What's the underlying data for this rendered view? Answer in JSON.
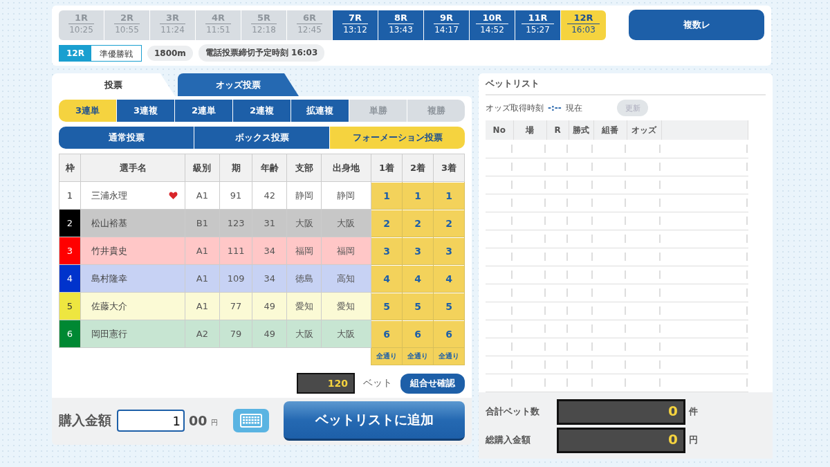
{
  "races": [
    {
      "label": "1R",
      "time": "10:25",
      "disabled": true,
      "selected": false
    },
    {
      "label": "2R",
      "time": "10:55",
      "disabled": true,
      "selected": false
    },
    {
      "label": "3R",
      "time": "11:24",
      "disabled": true,
      "selected": false
    },
    {
      "label": "4R",
      "time": "11:51",
      "disabled": true,
      "selected": false
    },
    {
      "label": "5R",
      "time": "12:18",
      "disabled": true,
      "selected": false
    },
    {
      "label": "6R",
      "time": "12:45",
      "disabled": true,
      "selected": false
    },
    {
      "label": "7R",
      "time": "13:12",
      "disabled": false,
      "selected": false
    },
    {
      "label": "8R",
      "time": "13:43",
      "disabled": false,
      "selected": false
    },
    {
      "label": "9R",
      "time": "14:17",
      "disabled": false,
      "selected": false
    },
    {
      "label": "10R",
      "time": "14:52",
      "disabled": false,
      "selected": false
    },
    {
      "label": "11R",
      "time": "15:27",
      "disabled": false,
      "selected": false
    },
    {
      "label": "12R",
      "time": "16:03",
      "disabled": false,
      "selected": true
    }
  ],
  "multi_race_button": "複数レ",
  "race_info": {
    "race": "12R",
    "name": "準優勝戦",
    "distance": "1800m",
    "deadline": "電話投票締切予定時刻 16:03"
  },
  "main_tabs": [
    {
      "label": "投票",
      "selected": true
    },
    {
      "label": "オッズ投票",
      "selected": false
    }
  ],
  "bet_types": [
    {
      "label": "3連単",
      "selected": true,
      "disabled": false
    },
    {
      "label": "3連複",
      "selected": false,
      "disabled": false
    },
    {
      "label": "2連単",
      "selected": false,
      "disabled": false
    },
    {
      "label": "2連複",
      "selected": false,
      "disabled": false
    },
    {
      "label": "拡連複",
      "selected": false,
      "disabled": false
    },
    {
      "label": "単勝",
      "selected": false,
      "disabled": true
    },
    {
      "label": "複勝",
      "selected": false,
      "disabled": true
    }
  ],
  "bet_methods": [
    {
      "label": "通常投票",
      "selected": false
    },
    {
      "label": "ボックス投票",
      "selected": false
    },
    {
      "label": "フォーメーション投票",
      "selected": true
    }
  ],
  "table": {
    "columns": [
      "枠",
      "選手名",
      "級別",
      "期",
      "年齢",
      "支部",
      "出身地",
      "1着",
      "2着",
      "3着"
    ],
    "rows": [
      {
        "frame": "1",
        "color": "#ffffff",
        "name": "三浦永理",
        "favorite": true,
        "class": "A1",
        "term": "91",
        "age": "42",
        "branch": "静岡",
        "birthplace": "静岡",
        "picks": [
          {
            "label": "1",
            "selected": true
          },
          {
            "label": "1",
            "selected": true
          },
          {
            "label": "1",
            "selected": true
          }
        ]
      },
      {
        "frame": "2",
        "color": "#000000",
        "name": "松山裕基",
        "favorite": false,
        "class": "B1",
        "term": "123",
        "age": "31",
        "branch": "大阪",
        "birthplace": "大阪",
        "picks": [
          {
            "label": "2",
            "selected": true
          },
          {
            "label": "2",
            "selected": true
          },
          {
            "label": "2",
            "selected": true
          }
        ]
      },
      {
        "frame": "3",
        "color": "#ff0000",
        "name": "竹井貴史",
        "favorite": false,
        "class": "A1",
        "term": "111",
        "age": "34",
        "branch": "福岡",
        "birthplace": "福岡",
        "picks": [
          {
            "label": "3",
            "selected": true
          },
          {
            "label": "3",
            "selected": true
          },
          {
            "label": "3",
            "selected": true
          }
        ]
      },
      {
        "frame": "4",
        "color": "#0033cc",
        "name": "島村隆幸",
        "favorite": false,
        "class": "A1",
        "term": "109",
        "age": "34",
        "branch": "徳島",
        "birthplace": "高知",
        "picks": [
          {
            "label": "4",
            "selected": true
          },
          {
            "label": "4",
            "selected": true
          },
          {
            "label": "4",
            "selected": true
          }
        ]
      },
      {
        "frame": "5",
        "color": "#eee640",
        "name": "佐藤大介",
        "favorite": false,
        "class": "A1",
        "term": "77",
        "age": "49",
        "branch": "愛知",
        "birthplace": "愛知",
        "picks": [
          {
            "label": "5",
            "selected": true
          },
          {
            "label": "5",
            "selected": true
          },
          {
            "label": "5",
            "selected": true
          }
        ]
      },
      {
        "frame": "6",
        "color": "#008833",
        "name": "岡田憲行",
        "favorite": false,
        "class": "A2",
        "term": "79",
        "age": "49",
        "branch": "大阪",
        "birthplace": "大阪",
        "picks": [
          {
            "label": "6",
            "selected": true
          },
          {
            "label": "6",
            "selected": true
          },
          {
            "label": "6",
            "selected": true
          }
        ]
      }
    ],
    "all_buttons": [
      "全通り",
      "全通り",
      "全通り"
    ]
  },
  "bet_count": {
    "value": "120",
    "unit": "ベット",
    "confirm": "組合せ確認"
  },
  "purchase": {
    "label": "購入金額",
    "value": "1",
    "suffix": "00",
    "unit": "円",
    "add_button": "ベットリストに追加"
  },
  "bet_list": {
    "title": "ベットリスト",
    "odds_time_label": "オッズ取得時刻",
    "odds_time": "-:--",
    "odds_time_suffix": "現在",
    "refresh": "更新",
    "columns": [
      "No",
      "場",
      "R",
      "勝式",
      "組番",
      "オッズ"
    ],
    "totals": [
      {
        "label": "合計ベット数",
        "value": "0",
        "unit": "件"
      },
      {
        "label": "総購入金額",
        "value": "0",
        "unit": "円"
      }
    ]
  }
}
